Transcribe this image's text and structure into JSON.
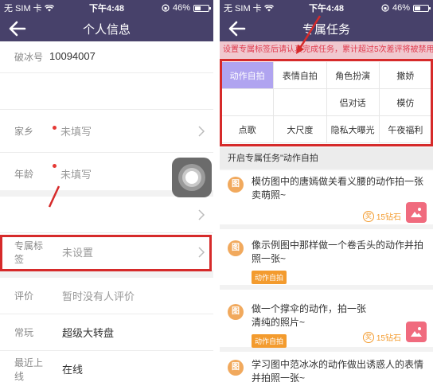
{
  "status": {
    "carrier": "无 SIM 卡",
    "time": "下午4:48",
    "battery_text": "46%",
    "battery_level": 0.46
  },
  "left": {
    "nav_title": "个人信息",
    "rows": {
      "ice_id": {
        "label": "破冰号",
        "value": "10094007"
      },
      "hometown": {
        "label": "家乡",
        "value": "未填写"
      },
      "age": {
        "label": "年龄",
        "value": "未填写"
      },
      "exclusive_tag": {
        "label": "专属标签",
        "value": "未设置"
      },
      "rating": {
        "label": "评价",
        "value": "暂时没有人评价"
      },
      "often_play": {
        "label": "常玩",
        "value": "超级大转盘"
      },
      "last_online": {
        "label": "最近上线",
        "value": "在线"
      }
    }
  },
  "right": {
    "nav_title": "专属任务",
    "notice": "设置专属标签后请认真完成任务，累计超过5次差评将被禁用",
    "tags_row1": [
      "动作自拍",
      "表情自拍",
      "角色扮演",
      "撒娇"
    ],
    "tags_row2": [
      "",
      "",
      "侣对话",
      "模仿"
    ],
    "tags_row3": [
      "点歌",
      "大尺度",
      "隐私大曝光",
      "午夜福利"
    ],
    "search_text": "开启专属任务\"动作自拍",
    "tasks": [
      {
        "icon": "图",
        "text": "模仿图中的唐嫣做关看义腰的动作拍一张卖萌照~",
        "reward_icon": "奖",
        "reward": "15钻石"
      },
      {
        "icon": "图",
        "text": "像示例图中那样做一个卷舌头的动作并拍照一张~",
        "chip": "动作自拍"
      },
      {
        "icon": "图",
        "text": "做一个撑伞的动作，拍一张清纯的照片~",
        "chip": "动作自拍",
        "reward_icon": "奖",
        "reward": "15钻石"
      },
      {
        "icon": "图",
        "text": "学习图中范冰冰的动作做出诱惑人的表情并拍照一张~"
      }
    ]
  },
  "colors": {
    "nav_bg": "#47416a",
    "highlight": "#d62a2a",
    "active_tag": "#b0a4f0",
    "orange": "#f39b2e",
    "pink_button": "#f06b7e"
  }
}
